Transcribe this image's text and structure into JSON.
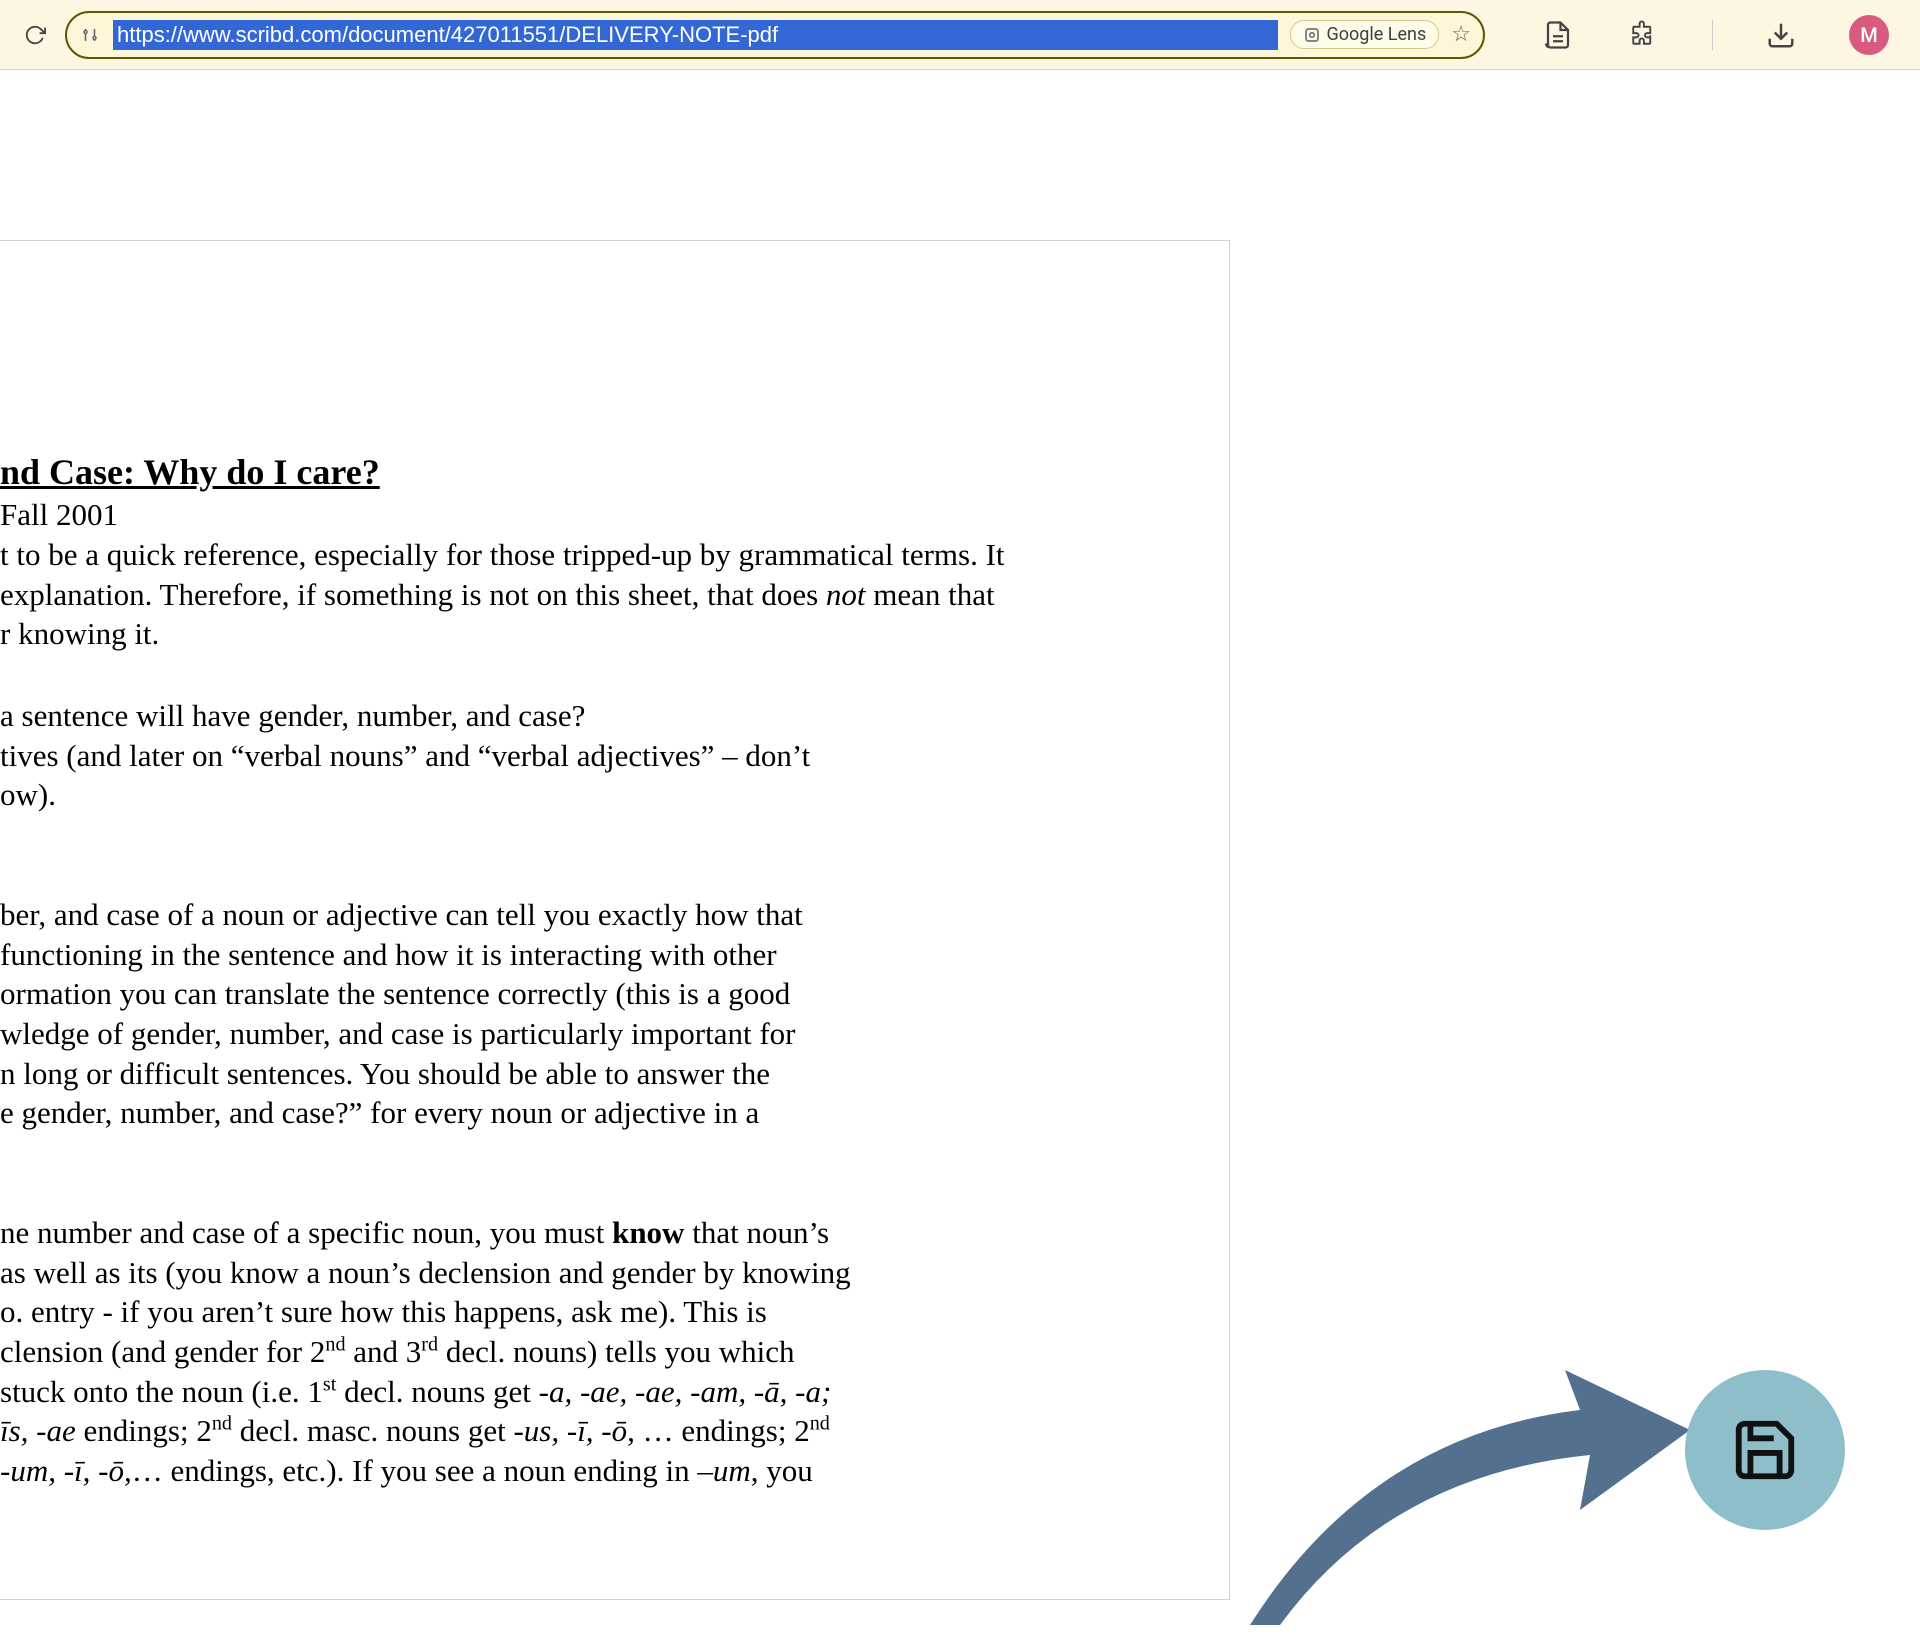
{
  "browser": {
    "url": "https://www.scribd.com/document/427011551/DELIVERY-NOTE-pdf",
    "lens_label": "Google Lens",
    "avatar_letter": "M"
  },
  "document": {
    "title": "nd Case: Why do I care?",
    "subtitle": "Fall 2001",
    "p1_l1": "t to be a quick reference, especially for those tripped-up by grammatical terms.  It",
    "p1_l2_a": "explanation.  Therefore, if something is not on this sheet, that does ",
    "p1_l2_not": "not",
    "p1_l2_b": " mean that",
    "p1_l3": "r knowing it.",
    "p2_l1": "a sentence will have gender, number, and case?",
    "p2_l2": "tives (and later on “verbal nouns” and “verbal adjectives” – don’t",
    "p2_l3": "ow).",
    "p3_l1": "ber, and case of a noun or adjective can tell you exactly how that",
    "p3_l2": "functioning in the sentence and how it is interacting with other",
    "p3_l3": "ormation you can translate the sentence correctly (this is a good",
    "p3_l4": "wledge of gender, number, and case is particularly important for",
    "p3_l5": "n long or difficult sentences.  You should be able to answer the",
    "p3_l6": "e gender, number, and case?” for every noun or adjective in a",
    "p4_l1_a": "ne number and case of a specific noun, you must ",
    "p4_l1_know": "know",
    "p4_l1_b": " that noun’s",
    "p4_l2": "as well as its (you know a noun’s declension and gender by knowing",
    "p4_l3": "o. entry - if you aren’t sure how this happens, ask me).  This is",
    "p4_l4_a": "clension (and gender for 2",
    "p4_l4_nd": "nd",
    "p4_l4_b": "  and 3",
    "p4_l4_rd": "rd",
    "p4_l4_c": " decl. nouns) tells you which",
    "p4_l5_a": " stuck onto the noun (i.e. 1",
    "p4_l5_st": "st",
    "p4_l5_b": " decl. nouns get ",
    "p4_l5_it": "-a, -ae, -ae, -am, -ā, -a;",
    "p4_l6_it1": "īs, -ae",
    "p4_l6_a": " endings; 2",
    "p4_l6_nd": "nd",
    "p4_l6_b": " decl. masc. nouns get ",
    "p4_l6_it2": "-us, -ī, -ō,",
    "p4_l6_c": " … endings; 2",
    "p4_l6_nd2": "nd",
    "p4_l7_it": " -um, -ī, -ō,",
    "p4_l7_a": "… endings, etc.).  If you see a noun ending in ",
    "p4_l7_it2": "–um",
    "p4_l7_b": ", you"
  }
}
